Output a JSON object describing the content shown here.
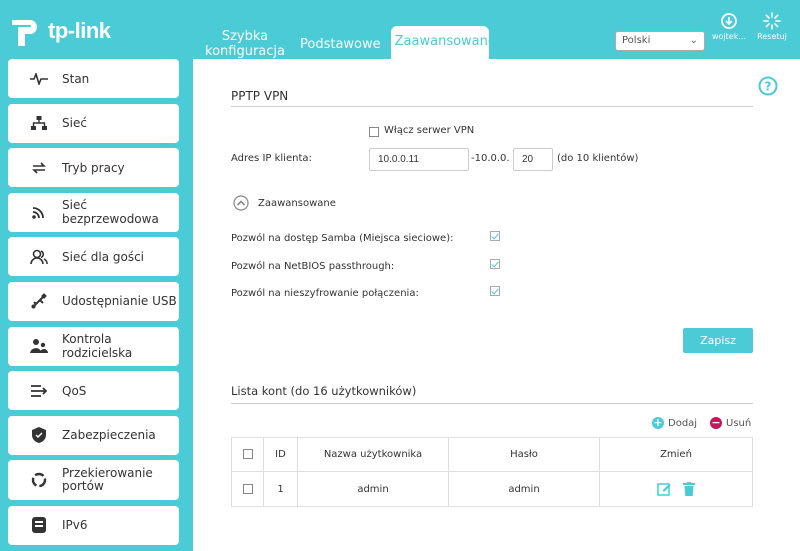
{
  "brand": {
    "logo_text": "tp-link"
  },
  "tabs": [
    {
      "label": "Szybka konfiguracja"
    },
    {
      "label": "Podstawowe"
    },
    {
      "label": "Zaawansowane"
    }
  ],
  "language": {
    "selected": "Polski"
  },
  "top_actions": {
    "user_label": "wojtek...",
    "reset_label": "Resetuj"
  },
  "sidebar": {
    "items": [
      {
        "label": "Stan",
        "icon": "pulse-icon"
      },
      {
        "label": "Sieć",
        "icon": "network-icon"
      },
      {
        "label": "Tryb pracy",
        "icon": "mode-switch-icon"
      },
      {
        "label": "Sieć bezprzewodowa",
        "icon": "wifi-icon"
      },
      {
        "label": "Sieć dla gości",
        "icon": "guests-icon"
      },
      {
        "label": "Udostępnianie USB",
        "icon": "usb-icon"
      },
      {
        "label": "Kontrola rodzicielska",
        "icon": "parental-icon"
      },
      {
        "label": "QoS",
        "icon": "qos-icon"
      },
      {
        "label": "Zabezpieczenia",
        "icon": "shield-icon"
      },
      {
        "label": "Przekierowanie portów",
        "icon": "nat-icon"
      },
      {
        "label": "IPv6",
        "icon": "ipv6-icon"
      }
    ]
  },
  "vpn": {
    "section_title": "PPTP VPN",
    "enable_label": "Włącz serwer VPN",
    "enable_checked": false,
    "client_ip_label": "Adres IP klienta:",
    "ip_start": "10.0.0.11",
    "ip_separator": "-10.0.0.",
    "ip_end": "20",
    "ip_hint": "(do 10 klientów)",
    "advanced_label": "Zaawansowane",
    "options": [
      {
        "label": "Pozwól na dostęp Samba (Miejsca sieciowe):",
        "checked": true
      },
      {
        "label": "Pozwól na NetBIOS passthrough:",
        "checked": true
      },
      {
        "label": "Pozwól na nieszyfrowanie połączenia:",
        "checked": true
      }
    ],
    "save_label": "Zapisz"
  },
  "accounts": {
    "section_title": "Lista kont (do 16 użytkowników)",
    "add_label": "Dodaj",
    "delete_label": "Usuń",
    "columns": [
      "ID",
      "Nazwa użytkownika",
      "Hasło",
      "Zmień"
    ],
    "rows": [
      {
        "id": "1",
        "username": "admin",
        "password": "admin"
      }
    ]
  },
  "colors": {
    "accent": "#4acbd6",
    "delete": "#c2185b"
  }
}
